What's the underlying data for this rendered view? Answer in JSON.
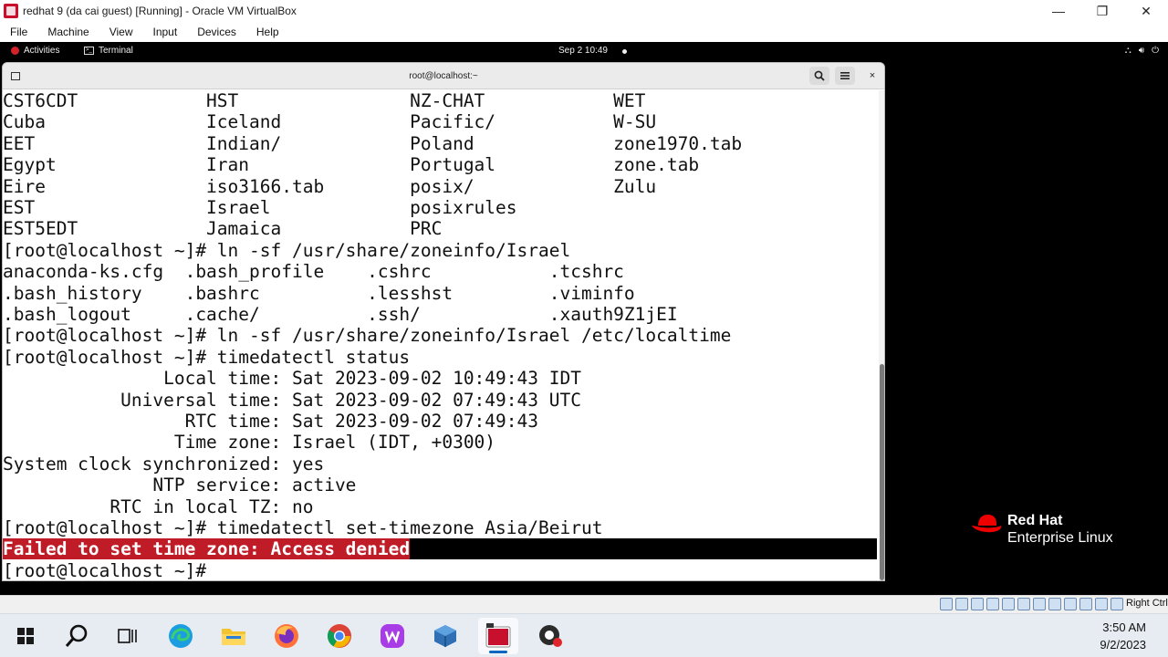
{
  "host_window": {
    "title": "redhat 9 (da cai guest) [Running] - Oracle VM VirtualBox",
    "controls": {
      "minimize": "—",
      "restore": "❐",
      "close": "✕"
    },
    "menu": [
      "File",
      "Machine",
      "View",
      "Input",
      "Devices",
      "Help"
    ]
  },
  "gnome": {
    "activities": "Activities",
    "app": "Terminal",
    "clock": "Sep 2  10:49"
  },
  "terminal": {
    "title": "root@localhost:~",
    "close_glyph": "×",
    "lines": [
      "CST6CDT            HST                NZ-CHAT            WET",
      "Cuba               Iceland            Pacific/           W-SU",
      "EET                Indian/            Poland             zone1970.tab",
      "Egypt              Iran               Portugal           zone.tab",
      "Eire               iso3166.tab        posix/             Zulu",
      "EST                Israel             posixrules",
      "EST5EDT            Jamaica            PRC",
      "[root@localhost ~]# ln -sf /usr/share/zoneinfo/Israel",
      "anaconda-ks.cfg  .bash_profile    .cshrc           .tcshrc",
      ".bash_history    .bashrc          .lesshst         .viminfo",
      ".bash_logout     .cache/          .ssh/            .xauth9Z1jEI",
      "[root@localhost ~]# ln -sf /usr/share/zoneinfo/Israel /etc/localtime",
      "[root@localhost ~]# timedatectl status",
      "               Local time: Sat 2023-09-02 10:49:43 IDT",
      "           Universal time: Sat 2023-09-02 07:49:43 UTC",
      "                 RTC time: Sat 2023-09-02 07:49:43",
      "                Time zone: Israel (IDT, +0300)",
      "System clock synchronized: yes",
      "              NTP service: active",
      "          RTC in local TZ: no",
      "[root@localhost ~]# timedatectl set-timezone Asia/Beirut"
    ],
    "error": "Failed to set time zone: Access denied",
    "prompt": "[root@localhost ~]#"
  },
  "branding": {
    "line1": "Red Hat",
    "line2": "Enterprise Linux"
  },
  "vbox_status": {
    "host_key": "Right Ctrl"
  },
  "taskbar": {
    "time": "3:50 AM",
    "date": "9/2/2023"
  },
  "colors": {
    "error_bg": "#c01c28",
    "redhat_red": "#ee0000",
    "taskbar_bg": "#e7ecf3"
  }
}
